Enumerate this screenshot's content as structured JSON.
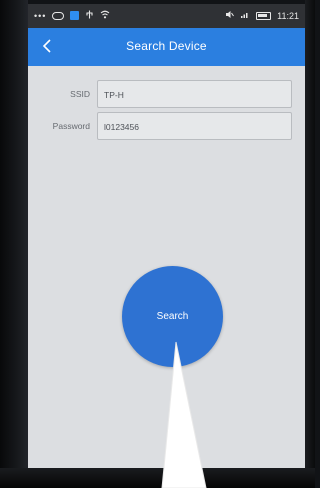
{
  "status_bar": {
    "time": "11:21",
    "left_icons": [
      "more-dots-icon",
      "cloud-icon",
      "app-icon",
      "usb-icon",
      "wifi-icon"
    ],
    "right_icons": [
      "mute-icon",
      "signal-icon",
      "battery-icon"
    ]
  },
  "app_bar": {
    "back_icon": "chevron-left-icon",
    "title": "Search Device"
  },
  "form": {
    "ssid_label": "SSID",
    "ssid_value": "TP-H",
    "password_label": "Password",
    "password_value": "l0123456"
  },
  "search_button": {
    "label": "Search"
  },
  "colors": {
    "accent": "#2b7fe0",
    "button": "#2e72d2",
    "screen_background": "#dcdee1"
  }
}
